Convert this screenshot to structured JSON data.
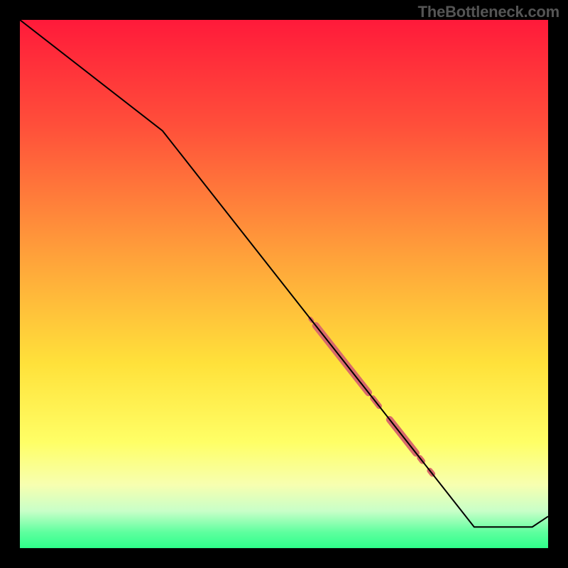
{
  "watermark": "TheBottleneck.com",
  "chart_data": {
    "type": "line",
    "title": "",
    "xlabel": "",
    "ylabel": "",
    "xlim": [
      0,
      100
    ],
    "ylim": [
      0,
      100
    ],
    "grid": false,
    "series": [
      {
        "name": "curve",
        "x": [
          0,
          27,
          86,
          97,
          100
        ],
        "y": [
          100,
          79,
          4,
          4,
          6
        ],
        "color": "#000000",
        "stroke_width": 2
      }
    ],
    "highlight_segments": [
      {
        "x_start": 55.0,
        "x_end": 55.3,
        "color": "#d86a6a",
        "width": 6
      },
      {
        "x_start": 56.0,
        "x_end": 66.0,
        "color": "#d86a6a",
        "width": 10
      },
      {
        "x_start": 66.8,
        "x_end": 68.0,
        "color": "#d86a6a",
        "width": 8
      },
      {
        "x_start": 70.0,
        "x_end": 75.0,
        "color": "#d86a6a",
        "width": 10
      },
      {
        "x_start": 75.7,
        "x_end": 76.2,
        "color": "#d86a6a",
        "width": 8
      },
      {
        "x_start": 77.6,
        "x_end": 78.1,
        "color": "#d86a6a",
        "width": 8
      }
    ],
    "background_gradient": {
      "stops": [
        {
          "offset": 0.0,
          "color": "#ff1a3a"
        },
        {
          "offset": 0.2,
          "color": "#ff4f3a"
        },
        {
          "offset": 0.45,
          "color": "#ffa23a"
        },
        {
          "offset": 0.65,
          "color": "#ffe13a"
        },
        {
          "offset": 0.8,
          "color": "#ffff66"
        },
        {
          "offset": 0.88,
          "color": "#f7ffb0"
        },
        {
          "offset": 0.93,
          "color": "#c8ffc8"
        },
        {
          "offset": 0.97,
          "color": "#5eff9f"
        },
        {
          "offset": 1.0,
          "color": "#2eff8a"
        }
      ]
    }
  }
}
